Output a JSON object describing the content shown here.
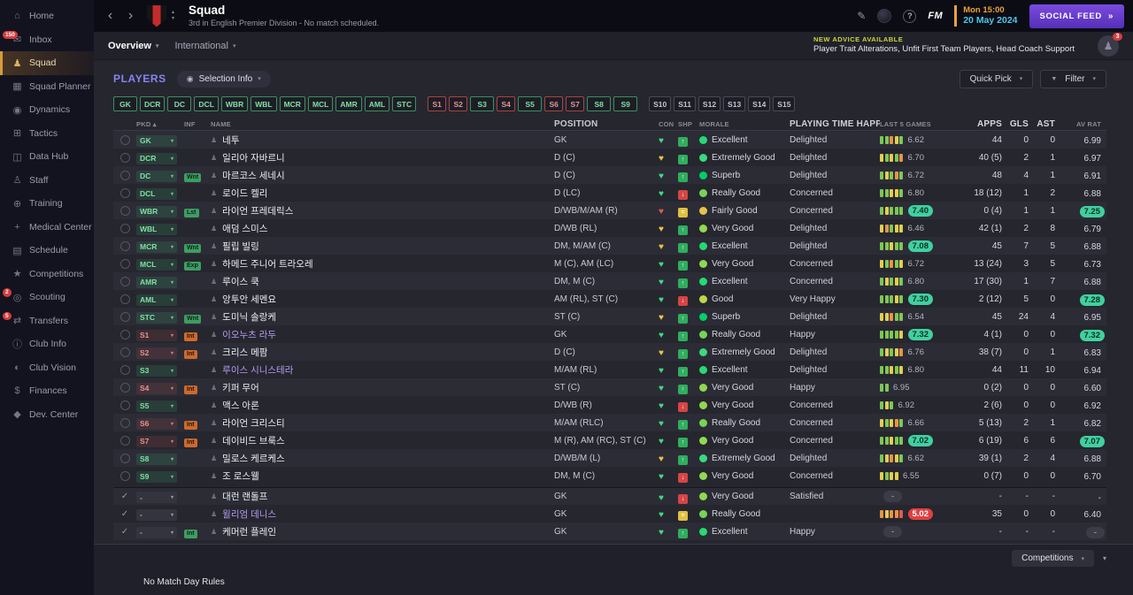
{
  "sidebar": {
    "items": [
      {
        "id": "home",
        "label": "Home",
        "glyph": "⌂"
      },
      {
        "id": "inbox",
        "label": "Inbox",
        "glyph": "✉",
        "badge": "150"
      },
      {
        "id": "squad",
        "label": "Squad",
        "glyph": "♟",
        "active": true
      },
      {
        "id": "squad-planner",
        "label": "Squad Planner",
        "glyph": "▦"
      },
      {
        "id": "dynamics",
        "label": "Dynamics",
        "glyph": "◉"
      },
      {
        "id": "tactics",
        "label": "Tactics",
        "glyph": "⊞"
      },
      {
        "id": "data-hub",
        "label": "Data Hub",
        "glyph": "◫"
      },
      {
        "id": "staff",
        "label": "Staff",
        "glyph": "♙"
      },
      {
        "id": "training",
        "label": "Training",
        "glyph": "⊕"
      },
      {
        "id": "medical-center",
        "label": "Medical Center",
        "glyph": "+"
      },
      {
        "id": "schedule",
        "label": "Schedule",
        "glyph": "▤"
      },
      {
        "id": "competitions",
        "label": "Competitions",
        "glyph": "★"
      },
      {
        "id": "scouting",
        "label": "Scouting",
        "glyph": "◎",
        "badge": "2"
      },
      {
        "id": "transfers",
        "label": "Transfers",
        "glyph": "⇄",
        "badge": "5"
      },
      {
        "id": "club-info",
        "label": "Club Info",
        "glyph": "ⓘ"
      },
      {
        "id": "club-vision",
        "label": "Club Vision",
        "glyph": "◐"
      },
      {
        "id": "finances",
        "label": "Finances",
        "glyph": "$"
      },
      {
        "id": "dev-center",
        "label": "Dev. Center",
        "glyph": "◆"
      }
    ]
  },
  "topbar": {
    "title": "Squad",
    "subtitle": "3rd in English Premier Division - No match scheduled.",
    "fm_logo": "FM",
    "day_time": "Mon 15:00",
    "date": "20 May 2024",
    "social_feed": "SOCIAL FEED"
  },
  "tabs": {
    "overview": "Overview",
    "international": "International"
  },
  "advice": {
    "label": "NEW ADVICE AVAILABLE",
    "text": "Player Trait Alterations, Unfit First Team Players, Head Coach Support",
    "badge": "3"
  },
  "players_bar": {
    "title": "PLAYERS",
    "selection_info": "Selection Info",
    "quick_pick": "Quick Pick",
    "filter": "Filter",
    "position_filters": [
      {
        "label": "GK",
        "state": "green"
      },
      {
        "label": "DCR",
        "state": "green"
      },
      {
        "label": "DC",
        "state": "green"
      },
      {
        "label": "DCL",
        "state": "green"
      },
      {
        "label": "WBR",
        "state": "green"
      },
      {
        "label": "WBL",
        "state": "green"
      },
      {
        "label": "MCR",
        "state": "green"
      },
      {
        "label": "MCL",
        "state": "green"
      },
      {
        "label": "AMR",
        "state": "green"
      },
      {
        "label": "AML",
        "state": "green"
      },
      {
        "label": "STC",
        "state": "green"
      },
      {
        "label": "S1",
        "state": "red",
        "gap_before": true
      },
      {
        "label": "S2",
        "state": "red"
      },
      {
        "label": "S3",
        "state": "green"
      },
      {
        "label": "S4",
        "state": "red"
      },
      {
        "label": "S5",
        "state": "green"
      },
      {
        "label": "S6",
        "state": "red"
      },
      {
        "label": "S7",
        "state": "red"
      },
      {
        "label": "S8",
        "state": "green"
      },
      {
        "label": "S9",
        "state": "green"
      },
      {
        "label": "S10",
        "state": "plain",
        "gap_before": true
      },
      {
        "label": "S11",
        "state": "plain"
      },
      {
        "label": "S12",
        "state": "plain"
      },
      {
        "label": "S13",
        "state": "plain"
      },
      {
        "label": "S14",
        "state": "plain"
      },
      {
        "label": "S15",
        "state": "plain"
      }
    ]
  },
  "colors": {
    "con": {
      "green": "#3ddc84",
      "yellow": "#e8c547",
      "red": "#e05a4e"
    },
    "shp": {
      "up": {
        "color": "#2fae5e",
        "glyph": "↑"
      },
      "down": {
        "color": "#d64545",
        "glyph": "↓"
      },
      "flat": {
        "color": "#e0c040",
        "glyph": "="
      }
    },
    "morale": {
      "Superb": "#00cf66",
      "Excellent": "#27d873",
      "Extremely Good": "#3ad97f",
      "Really Good": "#77d455",
      "Very Good": "#8fd94f",
      "Good": "#bcd748",
      "Fairly Good": "#e5c447"
    },
    "bars": {
      "g": "#7dc855",
      "y": "#e3cd50",
      "o": "#e8924a",
      "r": "#e05a4e"
    },
    "accent_purple": "#6a44d8",
    "date_orange": "#e8a23c",
    "date_cyan": "#4cc8e8",
    "advice_yellow": "#c6d63e"
  },
  "table": {
    "columns": [
      {
        "key": "check",
        "label": ""
      },
      {
        "key": "pkd",
        "label": "PKD",
        "sort": "▴"
      },
      {
        "key": "inf",
        "label": "INF"
      },
      {
        "key": "name",
        "label": "NAME"
      },
      {
        "key": "pos",
        "label": "POSITION"
      },
      {
        "key": "con",
        "label": "CON"
      },
      {
        "key": "shp",
        "label": "SHP"
      },
      {
        "key": "morale",
        "label": "MORALE"
      },
      {
        "key": "hap",
        "label": "PLAYING TIME HAPPINESS"
      },
      {
        "key": "l5",
        "label": "LAST 5 GAMES"
      },
      {
        "key": "apps",
        "label": "APPS"
      },
      {
        "key": "gls",
        "label": "GLS"
      },
      {
        "key": "ast",
        "label": "AST"
      },
      {
        "key": "av",
        "label": "AV RAT"
      }
    ],
    "rows": [
      {
        "pkd": "GK",
        "pkd_state": "green",
        "inf": null,
        "name": "네투",
        "name_purple": false,
        "pos": "GK",
        "con": "green",
        "shp": "up",
        "morale": "Excellent",
        "happiness": "Delighted",
        "l5_bars": [
          "g",
          "g",
          "o",
          "y",
          "g"
        ],
        "l5": "6.62",
        "l5_pill": "none",
        "apps": "44",
        "gls": "0",
        "ast": "0",
        "av": "6.99",
        "av_pill": "none",
        "checked": false
      },
      {
        "pkd": "DCR",
        "pkd_state": "green",
        "inf": null,
        "name": "일리아 자바르니",
        "name_purple": false,
        "pos": "D (C)",
        "con": "yellow",
        "shp": "up",
        "morale": "Extremely Good",
        "happiness": "Delighted",
        "l5_bars": [
          "y",
          "g",
          "y",
          "g",
          "o"
        ],
        "l5": "6.70",
        "l5_pill": "none",
        "apps": "40 (5)",
        "gls": "2",
        "ast": "1",
        "av": "6.97",
        "av_pill": "none",
        "checked": false
      },
      {
        "pkd": "DC",
        "pkd_state": "green",
        "inf": {
          "text": "Wnt",
          "color": "green"
        },
        "name": "마르코스 세네시",
        "name_purple": false,
        "pos": "D (C)",
        "con": "green",
        "shp": "up",
        "morale": "Superb",
        "happiness": "Delighted",
        "l5_bars": [
          "g",
          "y",
          "g",
          "o",
          "g"
        ],
        "l5": "6.72",
        "l5_pill": "none",
        "apps": "48",
        "gls": "4",
        "ast": "1",
        "av": "6.91",
        "av_pill": "none",
        "checked": false
      },
      {
        "pkd": "DCL",
        "pkd_state": "green",
        "inf": null,
        "name": "로이드 켈리",
        "name_purple": false,
        "pos": "D (LC)",
        "con": "green",
        "shp": "down",
        "morale": "Really Good",
        "happiness": "Concerned",
        "l5_bars": [
          "g",
          "g",
          "y",
          "y",
          "g"
        ],
        "l5": "6.80",
        "l5_pill": "none",
        "apps": "18 (12)",
        "gls": "1",
        "ast": "2",
        "av": "6.88",
        "av_pill": "none",
        "checked": false
      },
      {
        "pkd": "WBR",
        "pkd_state": "green",
        "inf": {
          "text": "Lst",
          "color": "green"
        },
        "name": "라이언 프레데릭스",
        "name_purple": false,
        "pos": "D/WB/M/AM (R)",
        "con": "red",
        "shp": "flat",
        "morale": "Fairly Good",
        "happiness": "Concerned",
        "l5_bars": [
          "g",
          "y",
          "g",
          "g",
          "g"
        ],
        "l5": "7.40",
        "l5_pill": "teal",
        "apps": "0 (4)",
        "gls": "1",
        "ast": "1",
        "av": "7.25",
        "av_pill": "teal",
        "checked": false
      },
      {
        "pkd": "WBL",
        "pkd_state": "green",
        "inf": null,
        "name": "애덤 스미스",
        "name_purple": false,
        "pos": "D/WB (RL)",
        "con": "yellow",
        "shp": "up",
        "morale": "Very Good",
        "happiness": "Delighted",
        "l5_bars": [
          "y",
          "o",
          "g",
          "y",
          "y"
        ],
        "l5": "6.46",
        "l5_pill": "none",
        "apps": "42 (1)",
        "gls": "2",
        "ast": "8",
        "av": "6.79",
        "av_pill": "none",
        "checked": false
      },
      {
        "pkd": "MCR",
        "pkd_state": "green",
        "inf": {
          "text": "Wnt",
          "color": "green"
        },
        "name": "필립 빌링",
        "name_purple": false,
        "pos": "DM, M/AM (C)",
        "con": "yellow",
        "shp": "up",
        "morale": "Excellent",
        "happiness": "Delighted",
        "l5_bars": [
          "g",
          "g",
          "y",
          "g",
          "g"
        ],
        "l5": "7.08",
        "l5_pill": "teal",
        "apps": "45",
        "gls": "7",
        "ast": "5",
        "av": "6.88",
        "av_pill": "none",
        "checked": false
      },
      {
        "pkd": "MCL",
        "pkd_state": "green",
        "inf": {
          "text": "Exp",
          "color": "green"
        },
        "name": "하메드 주니어 트라오레",
        "name_purple": false,
        "pos": "M (C), AM (LC)",
        "con": "green",
        "shp": "up",
        "morale": "Very Good",
        "happiness": "Concerned",
        "l5_bars": [
          "y",
          "g",
          "o",
          "g",
          "y"
        ],
        "l5": "6.72",
        "l5_pill": "none",
        "apps": "13 (24)",
        "gls": "3",
        "ast": "5",
        "av": "6.73",
        "av_pill": "none",
        "checked": false
      },
      {
        "pkd": "AMR",
        "pkd_state": "green",
        "inf": null,
        "name": "루이스 쿡",
        "name_purple": false,
        "pos": "DM, M (C)",
        "con": "green",
        "shp": "up",
        "morale": "Excellent",
        "happiness": "Concerned",
        "l5_bars": [
          "g",
          "y",
          "g",
          "y",
          "g"
        ],
        "l5": "6.80",
        "l5_pill": "none",
        "apps": "17 (30)",
        "gls": "1",
        "ast": "7",
        "av": "6.88",
        "av_pill": "none",
        "checked": false
      },
      {
        "pkd": "AML",
        "pkd_state": "green",
        "inf": null,
        "name": "앙투안 세멘요",
        "name_purple": false,
        "pos": "AM (RL), ST (C)",
        "con": "green",
        "shp": "down",
        "morale": "Good",
        "happiness": "Very Happy",
        "l5_bars": [
          "g",
          "g",
          "g",
          "y",
          "g"
        ],
        "l5": "7.30",
        "l5_pill": "teal",
        "apps": "2 (12)",
        "gls": "5",
        "ast": "0",
        "av": "7.28",
        "av_pill": "teal",
        "checked": false
      },
      {
        "pkd": "STC",
        "pkd_state": "green",
        "inf": {
          "text": "Wnt",
          "color": "green"
        },
        "name": "도미닉 솔랑케",
        "name_purple": false,
        "pos": "ST (C)",
        "con": "yellow",
        "shp": "up",
        "morale": "Superb",
        "happiness": "Delighted",
        "l5_bars": [
          "y",
          "y",
          "o",
          "g",
          "g"
        ],
        "l5": "6.54",
        "l5_pill": "none",
        "apps": "45",
        "gls": "24",
        "ast": "4",
        "av": "6.95",
        "av_pill": "none",
        "checked": false
      },
      {
        "pkd": "S1",
        "pkd_state": "red",
        "inf": {
          "text": "Int",
          "color": "orange"
        },
        "name": "이오누츠 라두",
        "name_purple": true,
        "pos": "GK",
        "con": "green",
        "shp": "up",
        "morale": "Really Good",
        "happiness": "Happy",
        "l5_bars": [
          "g",
          "g",
          "g",
          "g",
          "y"
        ],
        "l5": "7.32",
        "l5_pill": "teal",
        "apps": "4 (1)",
        "gls": "0",
        "ast": "0",
        "av": "7.32",
        "av_pill": "teal",
        "checked": false
      },
      {
        "pkd": "S2",
        "pkd_state": "red",
        "inf": {
          "text": "Int",
          "color": "orange"
        },
        "name": "크리스 메팜",
        "name_purple": false,
        "pos": "D (C)",
        "con": "yellow",
        "shp": "up",
        "morale": "Extremely Good",
        "happiness": "Delighted",
        "l5_bars": [
          "g",
          "y",
          "g",
          "y",
          "o"
        ],
        "l5": "6.76",
        "l5_pill": "none",
        "apps": "38 (7)",
        "gls": "0",
        "ast": "1",
        "av": "6.83",
        "av_pill": "none",
        "checked": false
      },
      {
        "pkd": "S3",
        "pkd_state": "green",
        "inf": null,
        "name": "루이스 시니스테라",
        "name_purple": true,
        "pos": "M/AM (RL)",
        "con": "green",
        "shp": "up",
        "morale": "Excellent",
        "happiness": "Delighted",
        "l5_bars": [
          "g",
          "g",
          "y",
          "g",
          "y"
        ],
        "l5": "6.80",
        "l5_pill": "none",
        "apps": "44",
        "gls": "11",
        "ast": "10",
        "av": "6.94",
        "av_pill": "none",
        "checked": false
      },
      {
        "pkd": "S4",
        "pkd_state": "red",
        "inf": {
          "text": "Int",
          "color": "orange"
        },
        "name": "키퍼 무어",
        "name_purple": false,
        "pos": "ST (C)",
        "con": "green",
        "shp": "up",
        "morale": "Very Good",
        "happiness": "Happy",
        "l5_bars": [
          "g",
          "g"
        ],
        "l5": "6.95",
        "l5_pill": "none",
        "apps": "0 (2)",
        "gls": "0",
        "ast": "0",
        "av": "6.60",
        "av_pill": "none",
        "checked": false
      },
      {
        "pkd": "S5",
        "pkd_state": "green",
        "inf": null,
        "name": "맥스 아론",
        "name_purple": false,
        "pos": "D/WB (R)",
        "con": "green",
        "shp": "down",
        "morale": "Very Good",
        "happiness": "Concerned",
        "l5_bars": [
          "g",
          "y",
          "g"
        ],
        "l5": "6.92",
        "l5_pill": "none",
        "apps": "2 (6)",
        "gls": "0",
        "ast": "0",
        "av": "6.92",
        "av_pill": "none",
        "checked": false
      },
      {
        "pkd": "S6",
        "pkd_state": "red",
        "inf": {
          "text": "Int",
          "color": "orange"
        },
        "name": "라이언 크리스티",
        "name_purple": false,
        "pos": "M/AM (RLC)",
        "con": "green",
        "shp": "up",
        "morale": "Really Good",
        "happiness": "Concerned",
        "l5_bars": [
          "y",
          "g",
          "y",
          "o",
          "g"
        ],
        "l5": "6.66",
        "l5_pill": "none",
        "apps": "5 (13)",
        "gls": "2",
        "ast": "1",
        "av": "6.82",
        "av_pill": "none",
        "checked": false
      },
      {
        "pkd": "S7",
        "pkd_state": "red",
        "inf": {
          "text": "Int",
          "color": "orange"
        },
        "name": "데이비드 브룩스",
        "name_purple": false,
        "pos": "M (R), AM (RC), ST (C)",
        "con": "green",
        "shp": "up",
        "morale": "Very Good",
        "happiness": "Concerned",
        "l5_bars": [
          "g",
          "g",
          "y",
          "g",
          "g"
        ],
        "l5": "7.02",
        "l5_pill": "teal",
        "apps": "6 (19)",
        "gls": "6",
        "ast": "6",
        "av": "7.07",
        "av_pill": "teal",
        "checked": false
      },
      {
        "pkd": "S8",
        "pkd_state": "green",
        "inf": null,
        "name": "밀로스 케르케스",
        "name_purple": false,
        "pos": "D/WB/M (L)",
        "con": "yellow",
        "shp": "up",
        "morale": "Extremely Good",
        "happiness": "Delighted",
        "l5_bars": [
          "g",
          "y",
          "o",
          "y",
          "g"
        ],
        "l5": "6.62",
        "l5_pill": "none",
        "apps": "39 (1)",
        "gls": "2",
        "ast": "4",
        "av": "6.88",
        "av_pill": "none",
        "checked": false
      },
      {
        "pkd": "S9",
        "pkd_state": "green",
        "inf": null,
        "name": "조 로스웰",
        "name_purple": false,
        "pos": "DM, M (C)",
        "con": "green",
        "shp": "down",
        "morale": "Very Good",
        "happiness": "Concerned",
        "l5_bars": [
          "y",
          "g",
          "y",
          "y"
        ],
        "l5": "6.55",
        "l5_pill": "none",
        "apps": "0 (7)",
        "gls": "0",
        "ast": "0",
        "av": "6.70",
        "av_pill": "none",
        "checked": false
      },
      {
        "pkd": "-",
        "pkd_state": "none",
        "inf": null,
        "name": "대런 랜돌프",
        "name_purple": false,
        "pos": "GK",
        "con": "green",
        "shp": "down",
        "morale": "Very Good",
        "happiness": "Satisfied",
        "l5_bars": [],
        "l5": "-",
        "l5_pill": "gray",
        "apps": "-",
        "gls": "-",
        "ast": "-",
        "av": "-",
        "av_pill": "none",
        "checked": true,
        "group_break": true
      },
      {
        "pkd": "-",
        "pkd_state": "none",
        "inf": null,
        "name": "윌리엄 데니스",
        "name_purple": true,
        "pos": "GK",
        "con": "green",
        "shp": "flat",
        "morale": "Really Good",
        "happiness": "",
        "l5_bars": [
          "o",
          "y",
          "o",
          "o",
          "r"
        ],
        "l5": "5.02",
        "l5_pill": "red",
        "apps": "35",
        "gls": "0",
        "ast": "0",
        "av": "6.40",
        "av_pill": "none",
        "checked": true
      },
      {
        "pkd": "-",
        "pkd_state": "none",
        "inf": {
          "text": "Int",
          "color": "green"
        },
        "name": "케머런 플레인",
        "name_purple": false,
        "pos": "GK",
        "con": "green",
        "shp": "up",
        "morale": "Excellent",
        "happiness": "Happy",
        "l5_bars": [],
        "l5": "-",
        "l5_pill": "gray",
        "apps": "-",
        "gls": "-",
        "ast": "-",
        "av": "-",
        "av_pill": "gray",
        "checked": true
      }
    ]
  },
  "footer": {
    "competitions": "Competitions",
    "note": "No Match Day Rules"
  }
}
